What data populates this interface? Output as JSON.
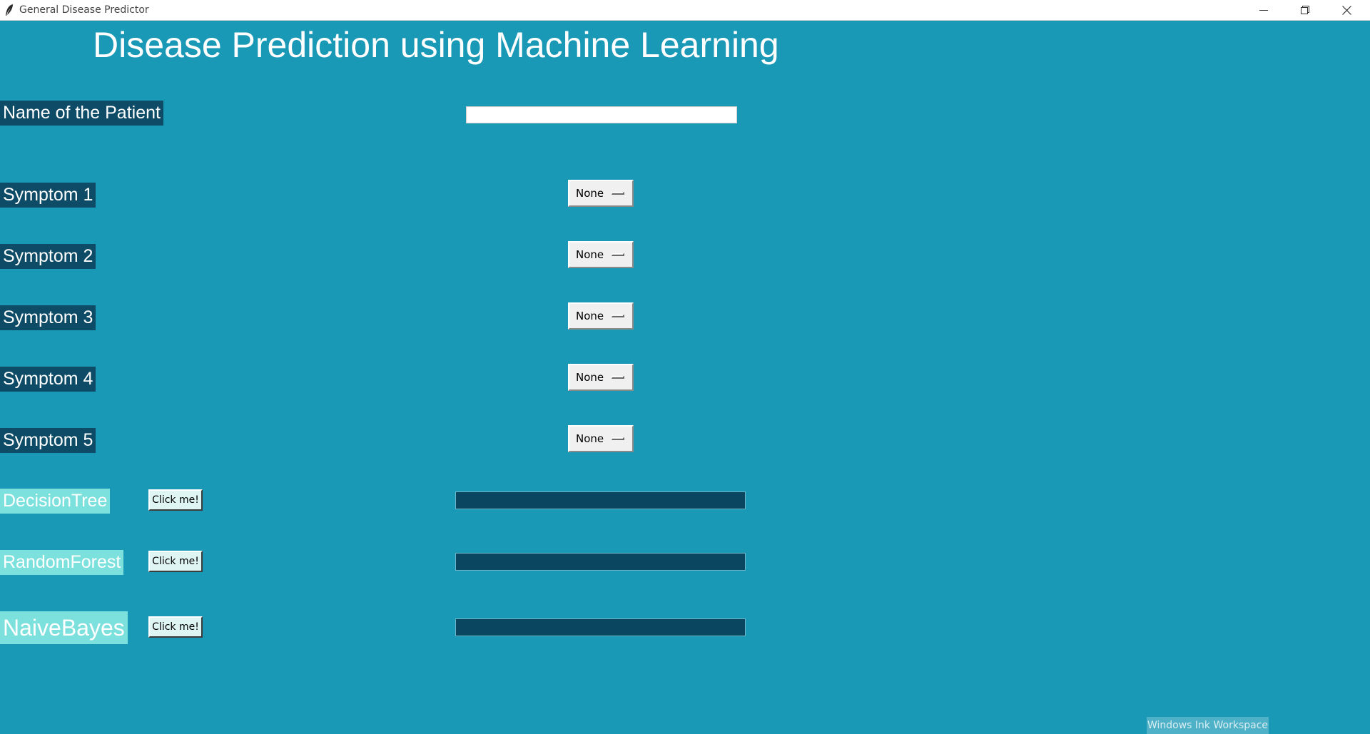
{
  "window": {
    "title": "General Disease Predictor",
    "icon": "feather-icon",
    "controls": [
      "minimize",
      "restore",
      "close"
    ]
  },
  "heading": "Disease Prediction using Machine Learning",
  "patient": {
    "label": "Name of the Patient",
    "value": ""
  },
  "symptoms": [
    {
      "label": "Symptom 1",
      "selected": "None"
    },
    {
      "label": "Symptom 2",
      "selected": "None"
    },
    {
      "label": "Symptom 3",
      "selected": "None"
    },
    {
      "label": "Symptom 4",
      "selected": "None"
    },
    {
      "label": "Symptom 5",
      "selected": "None"
    }
  ],
  "algorithms": [
    {
      "label": "DecisionTree",
      "button": "Click me!",
      "result": ""
    },
    {
      "label": "RandomForest",
      "button": "Click me!",
      "result": ""
    },
    {
      "label": "NaiveBayes",
      "button": "Click me!",
      "result": ""
    }
  ],
  "taskbar": {
    "ink_workspace": "Windows Ink Workspace"
  },
  "colors": {
    "background": "#1a99b6",
    "label_dark": "#0d4b66",
    "label_algo": "#7ce0dc",
    "result_box": "#0a4660"
  }
}
